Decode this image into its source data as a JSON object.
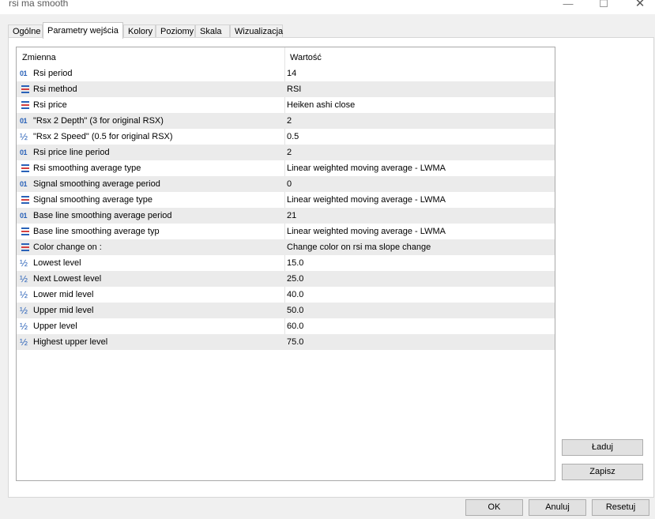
{
  "window": {
    "title": "rsi ma smooth",
    "minimize": "—",
    "maximize": "☐",
    "close": "✕"
  },
  "tabs": [
    {
      "label": "Ogólne"
    },
    {
      "label": "Parametry wejścia",
      "active": true
    },
    {
      "label": "Kolory"
    },
    {
      "label": "Poziomy"
    },
    {
      "label": "Skala"
    },
    {
      "label": "Wizualizacja"
    }
  ],
  "table": {
    "headers": {
      "name": "Zmienna",
      "value": "Wartość"
    },
    "rows": [
      {
        "icon": "integer-icon",
        "glyph": "01",
        "name": "Rsi period",
        "value": "14"
      },
      {
        "icon": "enum-icon",
        "glyph": "",
        "name": "Rsi method",
        "value": "RSI"
      },
      {
        "icon": "enum-icon",
        "glyph": "",
        "name": "Rsi price",
        "value": "Heiken ashi close"
      },
      {
        "icon": "integer-icon",
        "glyph": "01",
        "name": "\"Rsx 2 Depth\" (3 for original RSX)",
        "value": "2"
      },
      {
        "icon": "fraction-icon",
        "glyph": "½",
        "name": "\"Rsx 2 Speed\" (0.5 for original RSX)",
        "value": "0.5"
      },
      {
        "icon": "integer-icon",
        "glyph": "01",
        "name": "Rsi price line period",
        "value": "2"
      },
      {
        "icon": "enum-icon",
        "glyph": "",
        "name": "Rsi smoothing average type",
        "value": "Linear weighted moving average - LWMA"
      },
      {
        "icon": "integer-icon",
        "glyph": "01",
        "name": "Signal smoothing average period",
        "value": "0"
      },
      {
        "icon": "enum-icon",
        "glyph": "",
        "name": "Signal smoothing average type",
        "value": "Linear weighted moving average - LWMA"
      },
      {
        "icon": "integer-icon",
        "glyph": "01",
        "name": "Base line smoothing average period",
        "value": "21"
      },
      {
        "icon": "enum-icon",
        "glyph": "",
        "name": "Base line smoothing average typ",
        "value": "Linear weighted moving average - LWMA"
      },
      {
        "icon": "enum-icon",
        "glyph": "",
        "name": "Color change on :",
        "value": "Change color on rsi ma slope change"
      },
      {
        "icon": "fraction-icon",
        "glyph": "½",
        "name": "Lowest level",
        "value": "15.0"
      },
      {
        "icon": "fraction-icon",
        "glyph": "½",
        "name": "Next Lowest level",
        "value": "25.0"
      },
      {
        "icon": "fraction-icon",
        "glyph": "½",
        "name": "Lower mid level",
        "value": "40.0"
      },
      {
        "icon": "fraction-icon",
        "glyph": "½",
        "name": "Upper mid level",
        "value": "50.0"
      },
      {
        "icon": "fraction-icon",
        "glyph": "½",
        "name": "Upper level",
        "value": "60.0"
      },
      {
        "icon": "fraction-icon",
        "glyph": "½",
        "name": "Highest upper level",
        "value": "75.0"
      }
    ]
  },
  "buttons": {
    "load": "Ładuj",
    "save": "Zapisz",
    "ok": "OK",
    "cancel": "Anuluj",
    "reset": "Resetuj"
  },
  "colors": {
    "icon_blue": "#2a62b8",
    "icon_red": "#d44040",
    "row_alt": "#ebebeb"
  }
}
